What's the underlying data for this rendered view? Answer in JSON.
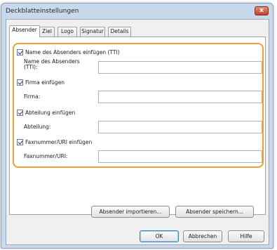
{
  "window": {
    "title": "Deckblatteinstellungen",
    "close_glyph": "x"
  },
  "tabs": [
    {
      "label": "Absender",
      "active": true
    },
    {
      "label": "Ziel",
      "active": false
    },
    {
      "label": "Logo",
      "active": false
    },
    {
      "label": "Signatur",
      "active": false
    },
    {
      "label": "Details",
      "active": false
    }
  ],
  "sender": {
    "name_check": "Name des Absenders einfügen (TTI)",
    "name_label": "Name des Absenders (TTI):",
    "name_value": "",
    "company_check": "Firma einfügen",
    "company_label": "Firma:",
    "company_value": "",
    "dept_check": "Abteilung einfügen",
    "dept_label": "Abteilung:",
    "dept_value": "",
    "fax_check": "Faxnummer/URI einfügen",
    "fax_label": "Faxnummer/URI:",
    "fax_value": ""
  },
  "buttons": {
    "import": "Absender importieren...",
    "save": "Absender speichern...",
    "ok": "OK",
    "cancel": "Abbrechen",
    "help": "Hilfe"
  },
  "colors": {
    "highlight": "#f0a030",
    "window_frame": "#c9d8ea",
    "close": "#c4432a"
  }
}
